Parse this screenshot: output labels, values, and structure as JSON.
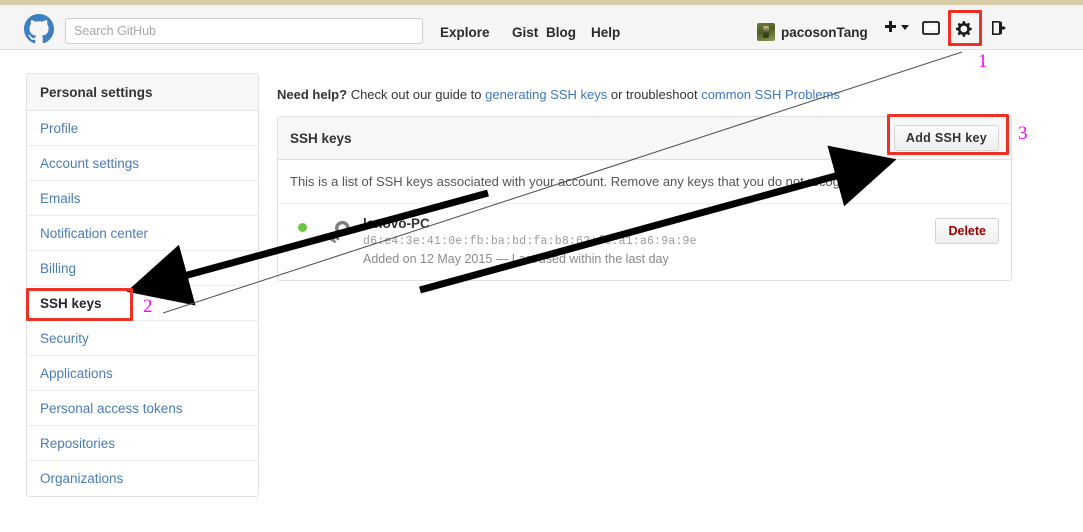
{
  "header": {
    "logo_icon": "github-octocat-icon",
    "logo_color": "#3f7fbf",
    "search_placeholder": "Search GitHub",
    "search_value": "",
    "nav": [
      {
        "label": "Explore"
      },
      {
        "label": "Gist"
      },
      {
        "label": "Blog"
      },
      {
        "label": "Help"
      }
    ],
    "user": {
      "name": "pacosonTang",
      "avatar_icon": "user-avatar"
    },
    "icons": [
      {
        "name": "plus-dropdown-icon",
        "glyph": "+"
      },
      {
        "name": "inbox-icon",
        "glyph": "inbox"
      },
      {
        "name": "gear-icon",
        "glyph": "gear"
      },
      {
        "name": "sign-out-icon",
        "glyph": "sign-out"
      }
    ]
  },
  "sidebar": {
    "title": "Personal settings",
    "items": [
      {
        "label": "Profile",
        "active": false
      },
      {
        "label": "Account settings",
        "active": false
      },
      {
        "label": "Emails",
        "active": false
      },
      {
        "label": "Notification center",
        "active": false
      },
      {
        "label": "Billing",
        "active": false
      },
      {
        "label": "SSH keys",
        "active": true
      },
      {
        "label": "Security",
        "active": false
      },
      {
        "label": "Applications",
        "active": false
      },
      {
        "label": "Personal access tokens",
        "active": false
      },
      {
        "label": "Repositories",
        "active": false
      },
      {
        "label": "Organizations",
        "active": false
      }
    ]
  },
  "help": {
    "lead": "Need help?",
    "text_1": " Check out our guide to ",
    "link_1": "generating SSH keys",
    "text_2": " or troubleshoot ",
    "link_2": "common SSH Problems"
  },
  "panel": {
    "title": "SSH keys",
    "add_button": "Add SSH key",
    "description": "This is a list of SSH keys associated with your account. Remove any keys that you do not recognize.",
    "keys": [
      {
        "status": "active",
        "status_color": "#6cc644",
        "icon": "key-icon",
        "title": "lenovo-PC",
        "fingerprint": "d6:e4:3e:41:0e:fb:ba:bd:fa:b8:62:fc:a1:a6:9a:9e",
        "meta": "Added on 12 May 2015 — Last used within the last day",
        "delete_label": "Delete"
      }
    ]
  },
  "annotations": {
    "box_color": "#ee3124",
    "number_color": "#ff00ff",
    "steps": [
      {
        "number": "1",
        "target": "gear-icon"
      },
      {
        "number": "2",
        "target": "sidebar-item-ssh-keys"
      },
      {
        "number": "3",
        "target": "add-ssh-key-button"
      }
    ]
  }
}
